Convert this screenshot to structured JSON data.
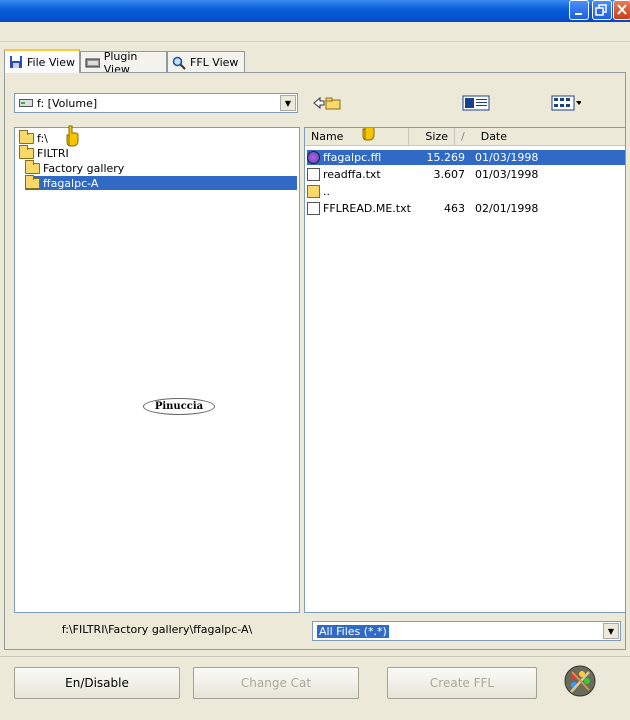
{
  "tabs": [
    {
      "label": "File View",
      "icon": "disk-icon",
      "active": true
    },
    {
      "label": "Plugin View",
      "icon": "plugin-icon",
      "active": false
    },
    {
      "label": "FFL View",
      "icon": "magnifier-icon",
      "active": false
    }
  ],
  "drive_select": {
    "value": "f: [Volume]"
  },
  "tree": {
    "items": [
      {
        "label": "f:\\"
      },
      {
        "label": "FILTRI"
      },
      {
        "label": "Factory gallery"
      },
      {
        "label": "ffagalpc-A",
        "selected": true
      }
    ],
    "watermark": "Pinuccia"
  },
  "file_list": {
    "headers": {
      "name": "Name",
      "size": "Size",
      "sort_mark": "/",
      "date": "Date"
    },
    "rows": [
      {
        "name": "ffagalpc.ffl",
        "size": "15.269",
        "date": "01/03/1998",
        "selected": true,
        "icon": "ffl-file-icon"
      },
      {
        "name": "readffa.txt",
        "size": "3.607",
        "date": "01/03/1998",
        "selected": false,
        "icon": "text-file-icon"
      },
      {
        "name": "..",
        "size": "",
        "date": "",
        "selected": false,
        "icon": "parent-folder-icon"
      },
      {
        "name": "FFLREAD.ME.txt",
        "size": "463",
        "date": "02/01/1998",
        "selected": false,
        "icon": "text-file-icon"
      }
    ]
  },
  "path_label": "f:\\FILTRI\\Factory gallery\\ffagalpc-A\\",
  "filter_select": {
    "value": "All Files (*.*)"
  },
  "buttons": {
    "enable_disable": "En/Disable",
    "change_cat": "Change Cat",
    "create_ffl": "Create FFL"
  },
  "colors": {
    "selection": "#316ac5",
    "titlebar": "#0a5fd8",
    "tab_highlight": "#ffc83c"
  }
}
